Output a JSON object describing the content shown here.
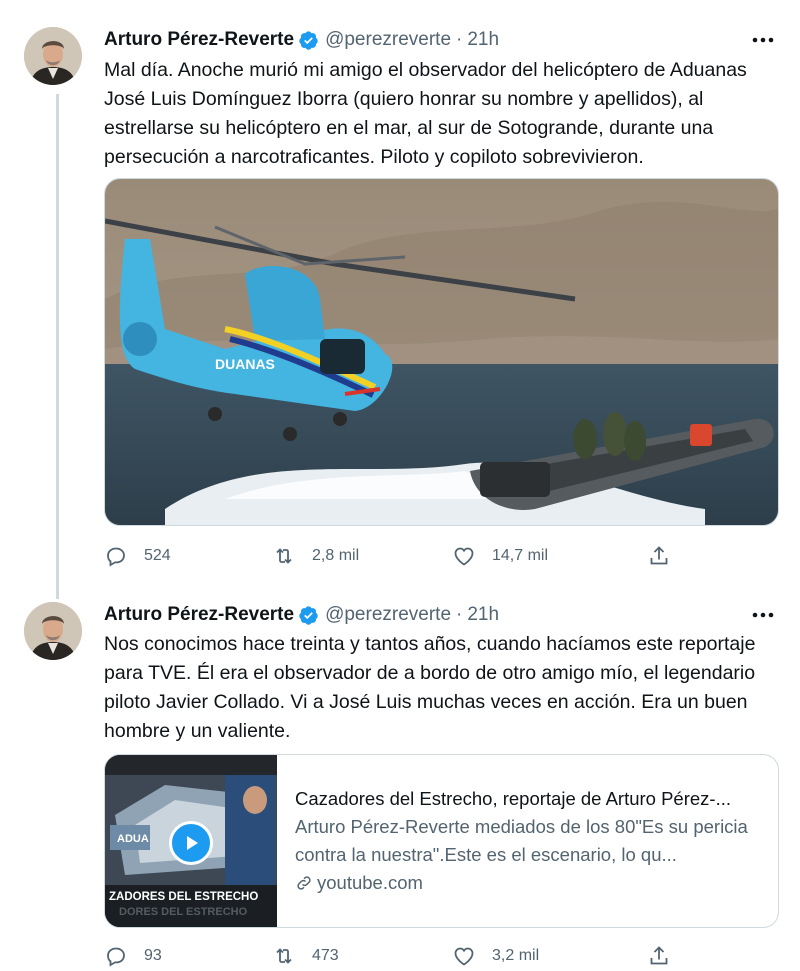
{
  "colors": {
    "accent": "#1d9bf0",
    "secondary_text": "#536471",
    "border": "#cfd9de"
  },
  "tweets": [
    {
      "author_name": "Arturo Pérez-Reverte",
      "handle": "@perezreverte",
      "separator": "·",
      "time": "21h",
      "text": "Mal día. Anoche murió mi amigo el observador del helicóptero de Aduanas José Luis Domínguez Iborra (quiero honrar su nombre y apellidos), al estrellarse su helicóptero en el mar, al sur de Sotogrande, durante una persecución a narcotraficantes. Piloto y copiloto sobrevivieron.",
      "media": {
        "icon": "helicopter-photo",
        "helicopter_label": "DUANAS"
      },
      "replies": "524",
      "retweets": "2,8 mil",
      "likes": "14,7 mil"
    },
    {
      "author_name": "Arturo Pérez-Reverte",
      "handle": "@perezreverte",
      "separator": "·",
      "time": "21h",
      "text": "Nos conocimos hace treinta y tantos años, cuando hacíamos este reportaje para TVE. Él era el observador de a bordo de otro amigo mío, el legendario piloto Javier Collado. Vi a José Luis muchas veces en acción. Era un buen hombre y un valiente.",
      "card": {
        "title": "Cazadores del Estrecho, reportaje de Arturo Pérez-...",
        "description": "Arturo Pérez-Reverte mediados de los 80\"Es su pericia contra la nuestra\".Este es el escenario, lo qu...",
        "domain": "youtube.com",
        "thumb_caption": "ZADORES DEL ESTRECHO",
        "thumb_caption_shadow": "DORES DEL ESTRECHO",
        "thumb_label": "ADUA"
      },
      "replies": "93",
      "retweets": "473",
      "likes": "3,2 mil"
    }
  ]
}
